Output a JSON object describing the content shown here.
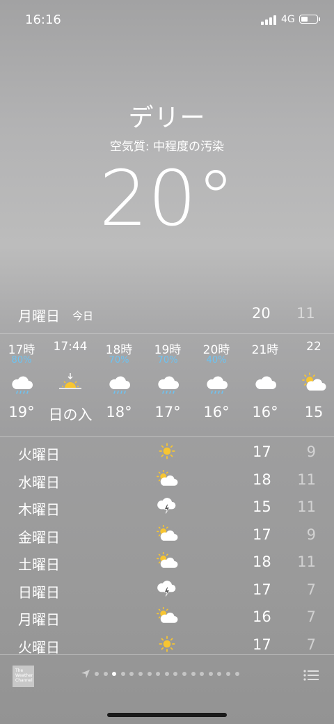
{
  "status_bar": {
    "time": "16:16",
    "network": "4G"
  },
  "header": {
    "city": "デリー",
    "air_quality": "空気質: 中程度の汚染",
    "temperature": "20°"
  },
  "today": {
    "day": "月曜日",
    "label": "今日",
    "high": "20",
    "low": "11"
  },
  "hourly": [
    {
      "time": "17時",
      "pop": "80%",
      "icon": "rain-cloud-icon",
      "temp": "19°"
    },
    {
      "time": "17:44",
      "pop": "",
      "icon": "sunset-icon",
      "temp": "日の入"
    },
    {
      "time": "18時",
      "pop": "70%",
      "icon": "rain-cloud-icon",
      "temp": "18°"
    },
    {
      "time": "19時",
      "pop": "70%",
      "icon": "rain-cloud-icon",
      "temp": "17°"
    },
    {
      "time": "20時",
      "pop": "40%",
      "icon": "rain-cloud-icon",
      "temp": "16°"
    },
    {
      "time": "21時",
      "pop": "",
      "icon": "cloud-icon",
      "temp": "16°"
    },
    {
      "time": "22",
      "pop": "",
      "icon": "partly-cloudy-icon",
      "temp": "15"
    }
  ],
  "daily": [
    {
      "day": "火曜日",
      "icon": "sun-icon",
      "high": "17",
      "low": "9"
    },
    {
      "day": "水曜日",
      "icon": "partly-cloudy-icon",
      "high": "18",
      "low": "11"
    },
    {
      "day": "木曜日",
      "icon": "thunderstorm-icon",
      "high": "15",
      "low": "11"
    },
    {
      "day": "金曜日",
      "icon": "partly-cloudy-icon",
      "high": "17",
      "low": "9"
    },
    {
      "day": "土曜日",
      "icon": "partly-cloudy-icon",
      "high": "18",
      "low": "11"
    },
    {
      "day": "日曜日",
      "icon": "thunderstorm-icon",
      "high": "17",
      "low": "7"
    },
    {
      "day": "月曜日",
      "icon": "partly-cloudy-icon",
      "high": "16",
      "low": "7"
    },
    {
      "day": "火曜日",
      "icon": "sun-icon",
      "high": "17",
      "low": "7"
    }
  ],
  "footer": {
    "provider_logo_text": "The Weather Channel",
    "page_count": 17,
    "active_page_index": 2
  },
  "colors": {
    "precipitation": "#6cc3f2",
    "sun": "#f7c531"
  }
}
